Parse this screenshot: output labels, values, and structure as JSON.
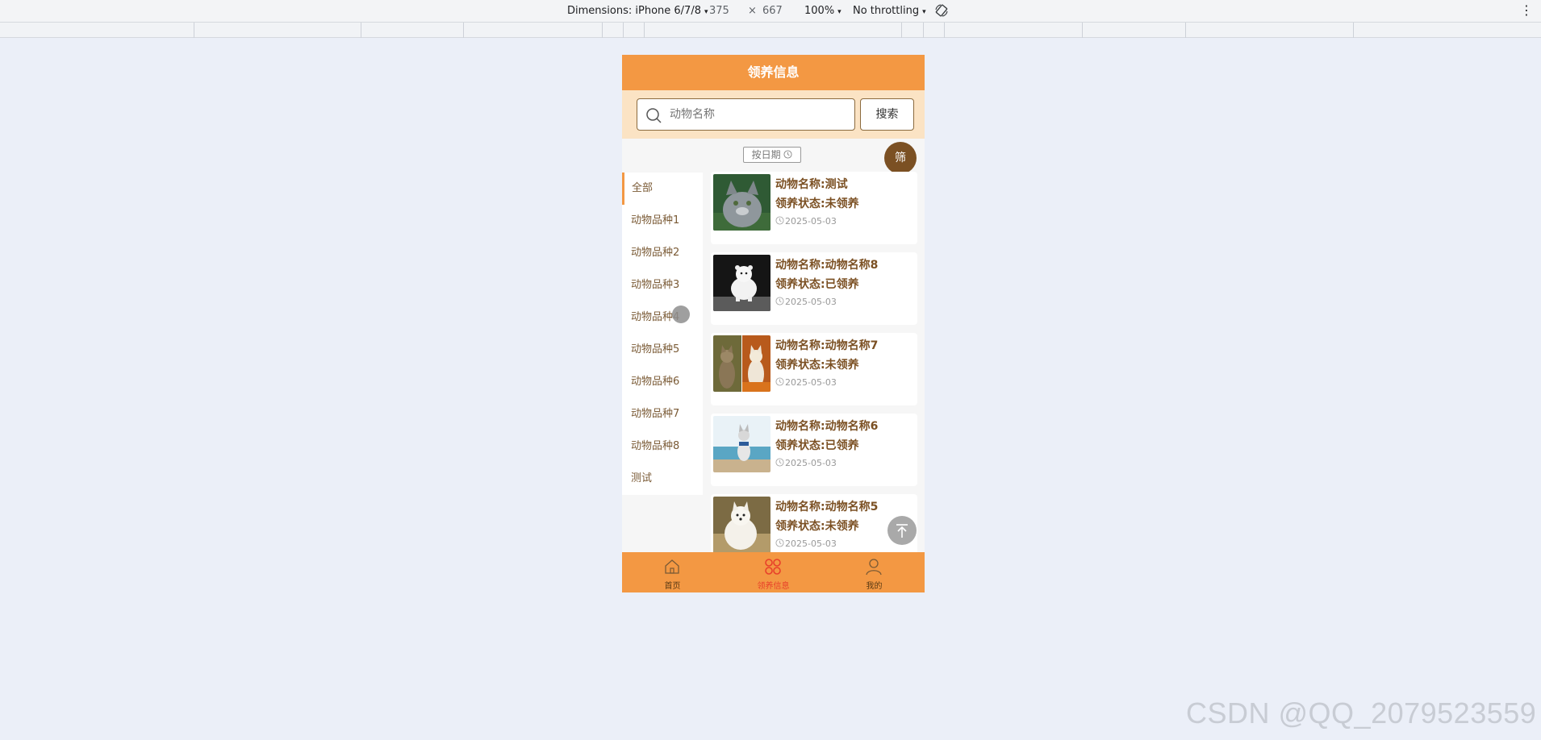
{
  "devtools": {
    "dimensions_label": "Dimensions: iPhone 6/7/8",
    "width": "375",
    "times": "×",
    "height": "667",
    "zoom": "100%",
    "throttling": "No throttling",
    "caret": "▾",
    "more": "⋮"
  },
  "header": {
    "title": "领养信息"
  },
  "search": {
    "placeholder": "动物名称",
    "button_label": "搜索",
    "icon": "search-icon"
  },
  "sort": {
    "label": "按日期"
  },
  "filter_fab": {
    "label": "筛"
  },
  "sidebar": {
    "active_index": 0,
    "items": [
      {
        "label": "全部"
      },
      {
        "label": "动物品种1"
      },
      {
        "label": "动物品种2"
      },
      {
        "label": "动物品种3"
      },
      {
        "label": "动物品种4"
      },
      {
        "label": "动物品种5"
      },
      {
        "label": "动物品种6"
      },
      {
        "label": "动物品种7"
      },
      {
        "label": "动物品种8"
      },
      {
        "label": "测试"
      }
    ]
  },
  "cards": [
    {
      "name": "动物名称:测试",
      "status": "领养状态:未领养",
      "date": "2025-05-03",
      "thumb": "gray-cat-photo"
    },
    {
      "name": "动物名称:动物名称8",
      "status": "领养状态:已领养",
      "date": "2025-05-03",
      "thumb": "white-ferret-photo"
    },
    {
      "name": "动物名称:动物名称7",
      "status": "领养状态:未领养",
      "date": "2025-05-03",
      "thumb": "two-cats-photo"
    },
    {
      "name": "动物名称:动物名称6",
      "status": "领养状态:已领养",
      "date": "2025-05-03",
      "thumb": "dog-beach-photo"
    },
    {
      "name": "动物名称:动物名称5",
      "status": "领养状态:未领养",
      "date": "2025-05-03",
      "thumb": "white-dog-photo"
    }
  ],
  "tabbar": {
    "active_index": 1,
    "items": [
      {
        "label": "首页",
        "icon": "home-icon"
      },
      {
        "label": "领养信息",
        "icon": "grid-icon"
      },
      {
        "label": "我的",
        "icon": "user-icon"
      }
    ]
  },
  "colors": {
    "primary": "#f39843",
    "brown": "#7b5023",
    "search_bg": "#fbe3c4",
    "page_bg": "#ebeff8"
  },
  "watermark": "CSDN @QQ_2079523559"
}
